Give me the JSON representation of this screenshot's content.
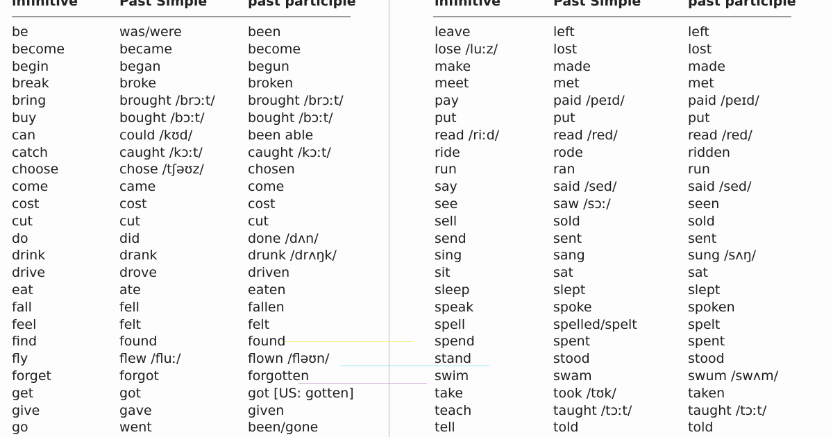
{
  "tables": [
    {
      "headers": [
        "infinitive",
        "Past Simple",
        "past participle"
      ],
      "rows": [
        [
          "be",
          "was/were",
          "been"
        ],
        [
          "become",
          "became",
          "become"
        ],
        [
          "begin",
          "began",
          "begun"
        ],
        [
          "break",
          "broke",
          "broken"
        ],
        [
          "bring",
          "brought /brɔːt/",
          "brought /brɔːt/"
        ],
        [
          "buy",
          "bought /bɔːt/",
          "bought /bɔːt/"
        ],
        [
          "can",
          "could /kʊd/",
          "been able"
        ],
        [
          "catch",
          "caught /kɔːt/",
          "caught /kɔːt/"
        ],
        [
          "choose",
          "chose /tʃəʊz/",
          "chosen"
        ],
        [
          "come",
          "came",
          "come"
        ],
        [
          "cost",
          "cost",
          "cost"
        ],
        [
          "cut",
          "cut",
          "cut"
        ],
        [
          "do",
          "did",
          "done /dʌn/"
        ],
        [
          "drink",
          "drank",
          "drunk /drʌŋk/"
        ],
        [
          "drive",
          "drove",
          "driven"
        ],
        [
          "eat",
          "ate",
          "eaten"
        ],
        [
          "fall",
          "fell",
          "fallen"
        ],
        [
          "feel",
          "felt",
          "felt"
        ],
        [
          "find",
          "found",
          "found"
        ],
        [
          "fly",
          "flew /fluː/",
          "flown /fləʊn/"
        ],
        [
          "forget",
          "forgot",
          "forgotten"
        ],
        [
          "get",
          "got",
          "got [US: gotten]"
        ],
        [
          "give",
          "gave",
          "given"
        ],
        [
          "go",
          "went",
          "been/gone"
        ]
      ]
    },
    {
      "headers": [
        "infinitive",
        "Past Simple",
        "past participle"
      ],
      "rows": [
        [
          "leave",
          "left",
          "left"
        ],
        [
          "lose /luːz/",
          "lost",
          "lost"
        ],
        [
          "make",
          "made",
          "made"
        ],
        [
          "meet",
          "met",
          "met"
        ],
        [
          "pay",
          "paid /peɪd/",
          "paid /peɪd/"
        ],
        [
          "put",
          "put",
          "put"
        ],
        [
          "read /riːd/",
          "read /red/",
          "read /red/"
        ],
        [
          "ride",
          "rode",
          "ridden"
        ],
        [
          "run",
          "ran",
          "run"
        ],
        [
          "say",
          "said /sed/",
          "said /sed/"
        ],
        [
          "see",
          "saw /sɔː/",
          "seen"
        ],
        [
          "sell",
          "sold",
          "sold"
        ],
        [
          "send",
          "sent",
          "sent"
        ],
        [
          "sing",
          "sang",
          "sung /sʌŋ/"
        ],
        [
          "sit",
          "sat",
          "sat"
        ],
        [
          "sleep",
          "slept",
          "slept"
        ],
        [
          "speak",
          "spoke",
          "spoken"
        ],
        [
          "spell",
          "spelled/spelt",
          "spelt"
        ],
        [
          "spend",
          "spent",
          "spent"
        ],
        [
          "stand",
          "stood",
          "stood"
        ],
        [
          "swim",
          "swam",
          "swum /swʌm/"
        ],
        [
          "take",
          "took /tʊk/",
          "taken"
        ],
        [
          "teach",
          "taught /tɔːt/",
          "taught /tɔːt/"
        ],
        [
          "tell",
          "told",
          "told"
        ]
      ]
    }
  ]
}
